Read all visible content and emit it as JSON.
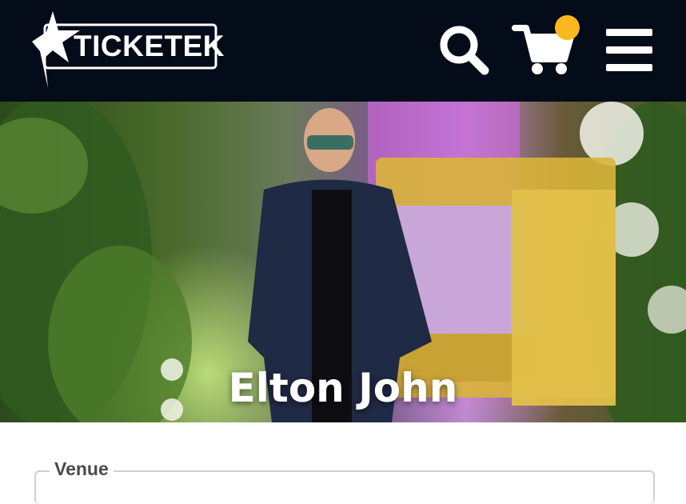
{
  "header": {
    "logo_text": "TICKETEK",
    "icons": {
      "search": "search-icon",
      "cart": "cart-icon",
      "menu": "hamburger-menu-icon"
    },
    "badge_color": "#f9b81f",
    "background_color": "#030c18"
  },
  "hero": {
    "title": "Elton John"
  },
  "filters": {
    "venue_label": "Venue"
  }
}
